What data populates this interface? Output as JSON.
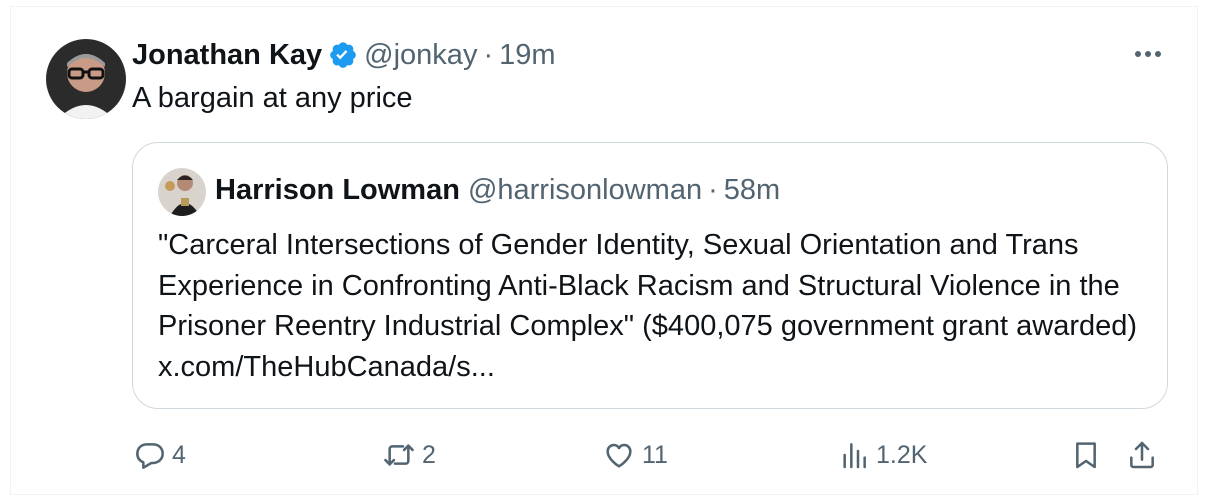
{
  "post": {
    "author_name": "Jonathan Kay",
    "handle": "@jonkay",
    "separator": "·",
    "time": "19m",
    "text": "A bargain at any price",
    "more_label": "More"
  },
  "quote": {
    "author_name": "Harrison Lowman",
    "handle": "@harrisonlowman",
    "separator": "·",
    "time": "58m",
    "text": "\"Carceral Intersections of Gender Identity, Sexual Orientation and Trans Experience in Confronting Anti-Black Racism and Structural Violence in the Prisoner Reentry Industrial Complex\" ($400,075 government grant awarded) x.com/TheHubCanada/s..."
  },
  "actions": {
    "replies": "4",
    "reposts": "2",
    "likes": "11",
    "views": "1.2K"
  },
  "colors": {
    "text": "#0f1419",
    "muted": "#536471",
    "verified": "#1d9bf0",
    "border": "#cfd9de"
  }
}
